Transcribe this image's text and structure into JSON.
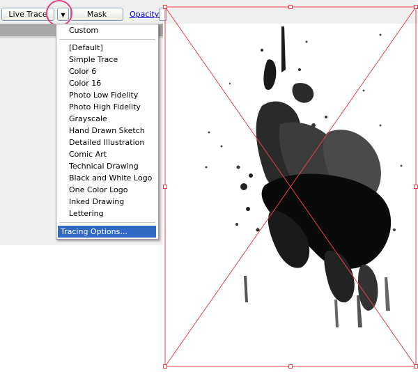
{
  "toolbar": {
    "live_trace_label": "Live Trace",
    "dropdown_arrow": "▼",
    "mask_label": "Mask",
    "opacity_label": "Opacity:"
  },
  "menu": {
    "custom": "Custom",
    "presets": [
      "[Default]",
      "Simple Trace",
      "Color 6",
      "Color 16",
      "Photo Low Fidelity",
      "Photo High Fidelity",
      "Grayscale",
      "Hand Drawn Sketch",
      "Detailed Illustration",
      "Comic Art",
      "Technical Drawing",
      "Black and White Logo",
      "One Color Logo",
      "Inked Drawing",
      "Lettering"
    ],
    "tracing_options": "Tracing Options..."
  },
  "colors": {
    "highlight_circle": "#e0407f",
    "selection_blue": "#316ac5",
    "bounding_box": "#e8404a"
  }
}
